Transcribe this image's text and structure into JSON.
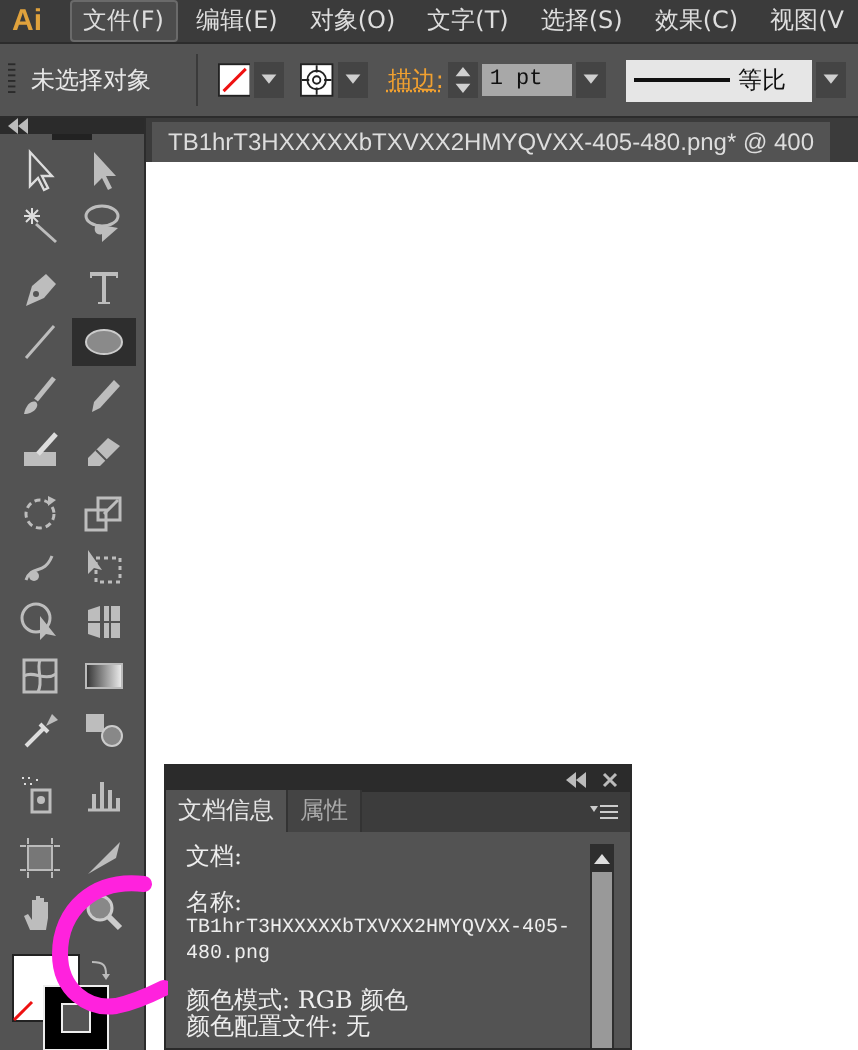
{
  "app_logo": "Ai",
  "menu": [
    {
      "label": "文件(F)",
      "selected": true
    },
    {
      "label": "编辑(E)",
      "selected": false
    },
    {
      "label": "对象(O)",
      "selected": false
    },
    {
      "label": "文字(T)",
      "selected": false
    },
    {
      "label": "选择(S)",
      "selected": false
    },
    {
      "label": "效果(C)",
      "selected": false
    },
    {
      "label": "视图(V",
      "selected": false
    }
  ],
  "control_bar": {
    "selection": "未选择对象",
    "stroke_label": "描边:",
    "stroke_weight": "1 pt",
    "profile": "等比"
  },
  "document_tab": {
    "title": "TB1hrT3HXXXXXbTXVXX2HMYQVXX-405-480.png* @ 400"
  },
  "toolbox": {
    "groups": [
      [
        {
          "kind": "selection",
          "selected": false
        },
        {
          "kind": "direct-selection",
          "selected": false
        },
        {
          "kind": "magic-wand",
          "selected": false
        },
        {
          "kind": "lasso",
          "selected": false
        }
      ],
      [
        {
          "kind": "pen",
          "selected": false
        },
        {
          "kind": "type",
          "selected": false
        },
        {
          "kind": "line",
          "selected": false
        },
        {
          "kind": "ellipse",
          "selected": true
        },
        {
          "kind": "paintbrush",
          "selected": false
        },
        {
          "kind": "pencil",
          "selected": false
        },
        {
          "kind": "blob-brush",
          "selected": false
        },
        {
          "kind": "eraser",
          "selected": false
        }
      ],
      [
        {
          "kind": "rotate",
          "selected": false
        },
        {
          "kind": "scale",
          "selected": false
        },
        {
          "kind": "warp",
          "selected": false
        },
        {
          "kind": "free-transform",
          "selected": false
        },
        {
          "kind": "shape-builder",
          "selected": false
        },
        {
          "kind": "graph-grid",
          "selected": false
        },
        {
          "kind": "mesh",
          "selected": false
        },
        {
          "kind": "gradient",
          "selected": false
        },
        {
          "kind": "eyedropper",
          "selected": false
        },
        {
          "kind": "blend",
          "selected": false
        }
      ],
      [
        {
          "kind": "spray",
          "selected": false
        },
        {
          "kind": "column-graph",
          "selected": false
        }
      ],
      [
        {
          "kind": "artboard",
          "selected": false
        },
        {
          "kind": "slice",
          "selected": false
        },
        {
          "kind": "hand",
          "selected": false
        },
        {
          "kind": "zoom",
          "selected": false
        }
      ]
    ]
  },
  "doc_info_panel": {
    "tabs": [
      {
        "label": "文档信息",
        "selected": true
      },
      {
        "label": "属性",
        "selected": false
      }
    ],
    "lines": [
      {
        "kind": "heading",
        "text": "文档:"
      },
      {
        "kind": "heading",
        "text": "名称:"
      },
      {
        "kind": "value",
        "text": "TB1hrT3HXXXXXbTXVXX2HMYQVXX-405-480.png"
      },
      {
        "kind": "heading",
        "text": "颜色模式: RGB 颜色"
      },
      {
        "kind": "plain",
        "text": "颜色配置文件: 无"
      }
    ]
  }
}
